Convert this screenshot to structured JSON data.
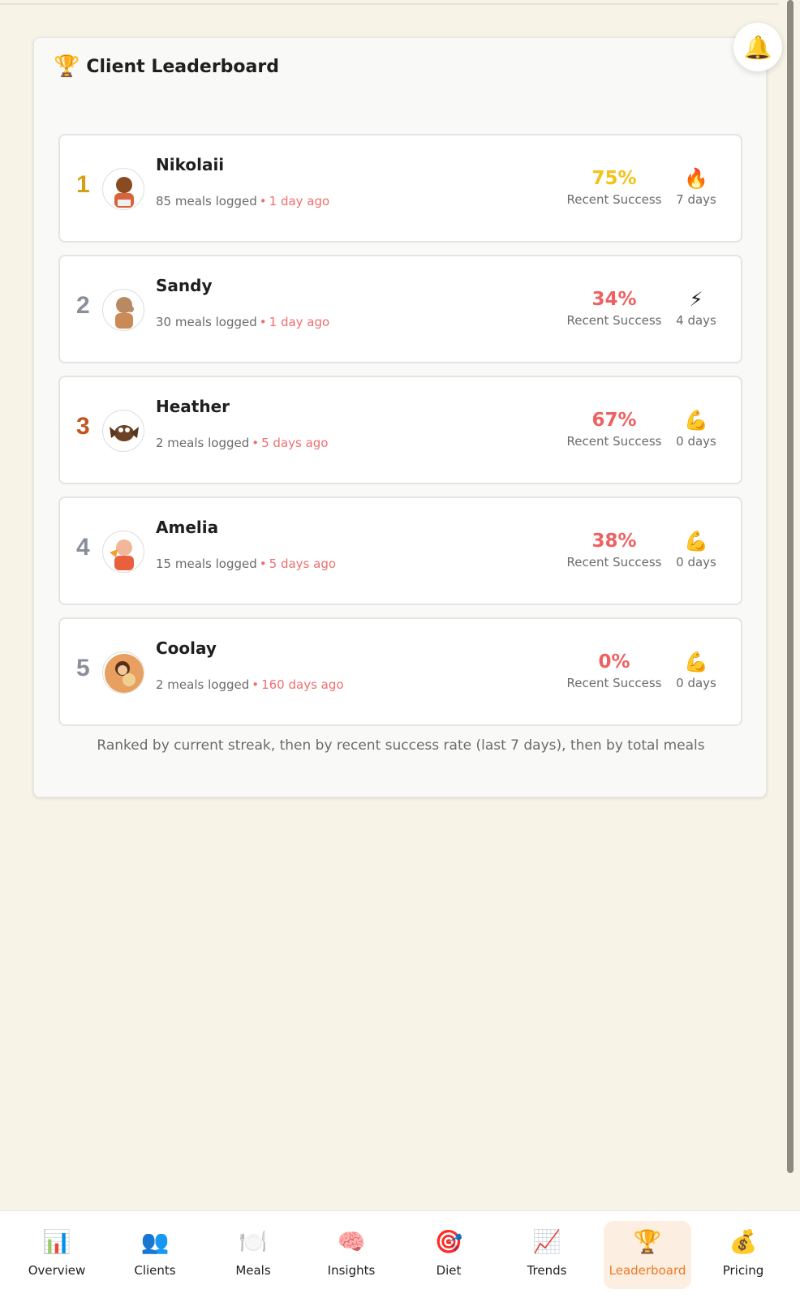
{
  "header": {
    "title": "Client Leaderboard",
    "icon": "trophy-icon"
  },
  "notifications": {
    "icon": "bell-icon"
  },
  "leaderboard": [
    {
      "rank": "1",
      "name": "Nikolaii",
      "meals": "85 meals logged",
      "ago": "1 day ago",
      "success": "75%",
      "success_label": "Recent Success",
      "streak_icon": "fire-icon",
      "streak": "7 days",
      "success_color": "#f2c318"
    },
    {
      "rank": "2",
      "name": "Sandy",
      "meals": "30 meals logged",
      "ago": "1 day ago",
      "success": "34%",
      "success_label": "Recent Success",
      "streak_icon": "lightning-icon",
      "streak": "4 days",
      "success_color": "#ef6161"
    },
    {
      "rank": "3",
      "name": "Heather",
      "meals": "2 meals logged",
      "ago": "5 days ago",
      "success": "67%",
      "success_label": "Recent Success",
      "streak_icon": "flexed-biceps-icon",
      "streak": "0 days",
      "success_color": "#ef6161"
    },
    {
      "rank": "4",
      "name": "Amelia",
      "meals": "15 meals logged",
      "ago": "5 days ago",
      "success": "38%",
      "success_label": "Recent Success",
      "streak_icon": "flexed-biceps-icon",
      "streak": "0 days",
      "success_color": "#ef6161"
    },
    {
      "rank": "5",
      "name": "Coolay",
      "meals": "2 meals logged",
      "ago": "160 days ago",
      "success": "0%",
      "success_label": "Recent Success",
      "streak_icon": "flexed-biceps-icon",
      "streak": "0 days",
      "success_color": "#ef6161"
    }
  ],
  "footnote": "Ranked by current streak, then by recent success rate (last 7 days), then by total meals",
  "nav": [
    {
      "label": "Overview",
      "icon": "bar-chart-icon"
    },
    {
      "label": "Clients",
      "icon": "clients-icon"
    },
    {
      "label": "Meals",
      "icon": "plate-icon"
    },
    {
      "label": "Insights",
      "icon": "brain-icon"
    },
    {
      "label": "Diet",
      "icon": "target-icon"
    },
    {
      "label": "Trends",
      "icon": "trend-chart-icon"
    },
    {
      "label": "Leaderboard",
      "icon": "trophy-icon",
      "active": true
    },
    {
      "label": "Pricing",
      "icon": "money-bag-icon"
    }
  ],
  "colors": {
    "accent": "#f07a22",
    "background": "#f7f3e6",
    "gold": "#f2c318",
    "red": "#ef6161"
  }
}
